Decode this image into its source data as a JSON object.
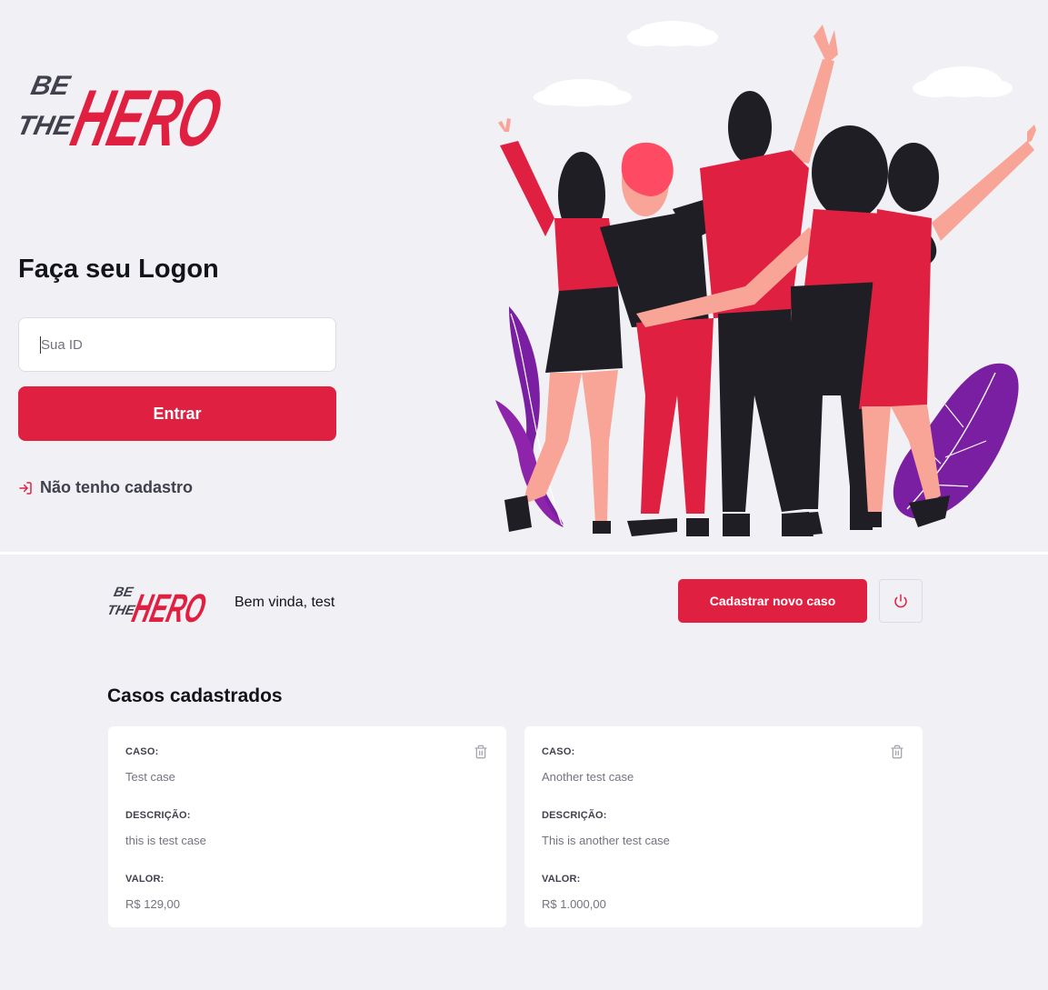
{
  "logo": {
    "be": "BE",
    "the": "THE",
    "hero": "HERO"
  },
  "logon": {
    "title": "Faça seu Logon",
    "id_placeholder": "Sua ID",
    "id_value": "",
    "submit_label": "Entrar",
    "register_label": "Não tenho cadastro",
    "register_icon": "log-in-icon",
    "illustration": "heroes-illustration"
  },
  "profile": {
    "welcome": "Bem vinda, test",
    "new_case_label": "Cadastrar novo caso",
    "logout_icon": "power-icon",
    "cases_title": "Casos cadastrados",
    "cases": [
      {
        "case_label": "CASO:",
        "title": "Test case",
        "description_label": "DESCRIÇÃO:",
        "description": "this is test case",
        "value_label": "VALOR:",
        "value": "R$ 129,00"
      },
      {
        "case_label": "CASO:",
        "title": "Another test case",
        "description_label": "DESCRIÇÃO:",
        "description": "This is another test case",
        "value_label": "VALOR:",
        "value": "R$ 1.000,00"
      }
    ]
  },
  "colors": {
    "accent": "#E02041",
    "background": "#F0F0F5",
    "text": "#13131A",
    "muted": "#737380",
    "purple": "#7B1FA2",
    "dark": "#1F1E24",
    "skin": "#F8A497"
  }
}
